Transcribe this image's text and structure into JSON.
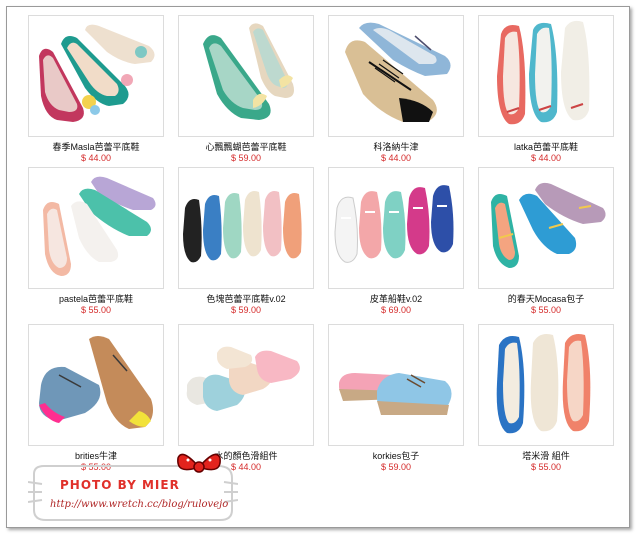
{
  "products": [
    {
      "name": "春季Masla芭蕾平底鞋",
      "price": "$ 44.00",
      "image": "ballet-flats-pink-teal-bows"
    },
    {
      "name": "心飄飄蝴芭蕾平底鞋",
      "price": "$ 59.00",
      "image": "ballet-flats-green-beige-heart"
    },
    {
      "name": "科洛納牛津",
      "price": "$ 44.00",
      "image": "oxford-shoes-beige-black-blue"
    },
    {
      "name": "latka芭蕾平底鞋",
      "price": "$ 44.00",
      "image": "ballet-flats-coral-aqua-white"
    },
    {
      "name": "pastela芭蕾平底鞋",
      "price": "$ 55.00",
      "image": "ballet-flats-pastel-lilac-mint"
    },
    {
      "name": "色塊芭蕾平底鞋v.02",
      "price": "$ 59.00",
      "image": "ballet-flats-six-colors"
    },
    {
      "name": "皮革船鞋v.02",
      "price": "$ 69.00",
      "image": "boat-shoes-five-colors"
    },
    {
      "name": "的春天Mocasa包子",
      "price": "$ 55.00",
      "image": "moccasins-teal-blue-lilac"
    },
    {
      "name": "brities牛津",
      "price": "$ 55.00",
      "image": "oxford-shoes-tan-pink-yellow-toe"
    },
    {
      "name": "水的顏色滑組件",
      "price": "$ 44.00",
      "image": "slip-ons-pastel-pink-blue"
    },
    {
      "name": "korkies包子",
      "price": "$ 59.00",
      "image": "espadrilles-pink-blue"
    },
    {
      "name": "塔米滑 組件",
      "price": "$ 55.00",
      "image": "slip-ons-blue-cream-coral"
    }
  ],
  "watermark": {
    "title": "PHOTO BY MIER",
    "url": "http://www.wretch.cc/blog/rulovejo",
    "icon": "hello-kitty-bow-icon"
  },
  "colors": {
    "price": "#d52b2b",
    "watermark": "#e0302a",
    "border": "#9a9a9a"
  }
}
